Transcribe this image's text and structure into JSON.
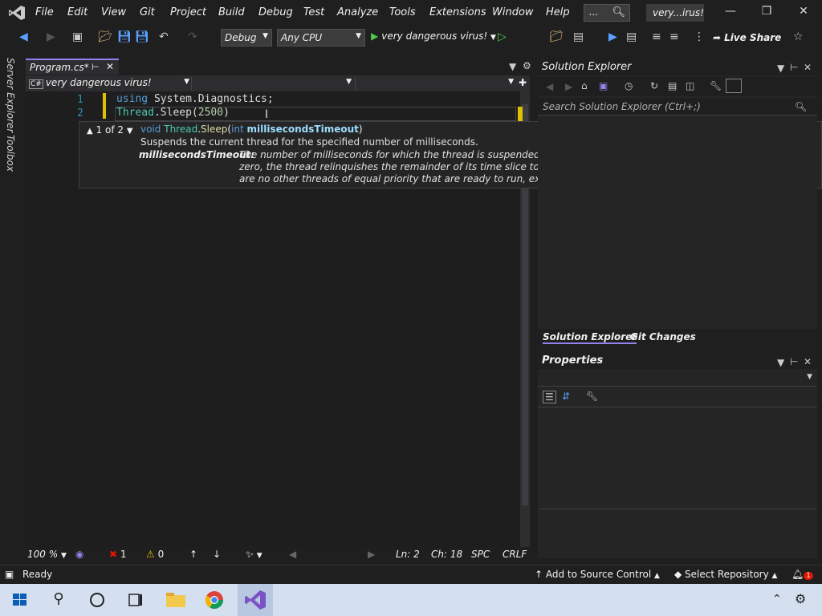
{
  "titlebar": {
    "menu": [
      "File",
      "Edit",
      "View",
      "Git",
      "Project",
      "Build",
      "Debug",
      "Test",
      "Analyze",
      "Tools",
      "Extensions",
      "Window",
      "Help"
    ],
    "search_text": "...",
    "solution_name": "very...irus!"
  },
  "toolbar": {
    "config": "Debug",
    "platform": "Any CPU",
    "run_target": "very dangerous virus!",
    "live_share": "Live Share"
  },
  "left_rail": {
    "server_explorer": "Server Explorer",
    "toolbox": "Toolbox"
  },
  "editor": {
    "tab_title": "Program.cs*",
    "nav_project": "very dangerous virus!",
    "lines": [
      {
        "num": "1"
      },
      {
        "num": "2"
      }
    ],
    "line1": {
      "kw": "using",
      "rest": " System.Diagnostics;"
    },
    "line2": {
      "type": "Thread",
      "method": ".Sleep(",
      "arg": "2500",
      "close": ")"
    },
    "tooltip": {
      "overload": "1 of 2",
      "sig_ret": "void",
      "sig_cls": "Thread",
      "sig_method": "Sleep",
      "sig_ptype": "int",
      "sig_pname": "millisecondsTimeout",
      "description": "Suspends the current thread for the specified number of milliseconds.",
      "param_label": "millisecondsTimeout:",
      "param_desc": "The number of milliseconds for which the thread is suspended. If the value of the millisecondsTimeout argument is zero, the thread relinquishes the remainder of its time slice to any thread of equal priority that is ready to run. If there are no other threads of equal priority that are ready to run, execution of the current thread is not suspended."
    },
    "status": {
      "zoom": "100 %",
      "errors": "1",
      "warnings": "0",
      "line": "Ln: 2",
      "col": "Ch: 18",
      "ws": "SPC",
      "eol": "CRLF"
    }
  },
  "solution_explorer": {
    "title": "Solution Explorer",
    "search_placeholder": "Search Solution Explorer (Ctrl+;)",
    "tabs": [
      "Solution Explorer",
      "Git Changes"
    ]
  },
  "properties": {
    "title": "Properties"
  },
  "statusbar": {
    "ready": "Ready",
    "add_source": "Add to Source Control",
    "select_repo": "Select Repository",
    "notifications": "1"
  },
  "colors": {
    "accent": "#9184ee",
    "taskbar": "#d4e0f0",
    "run": "#4ec94e",
    "error": "#e51400"
  }
}
